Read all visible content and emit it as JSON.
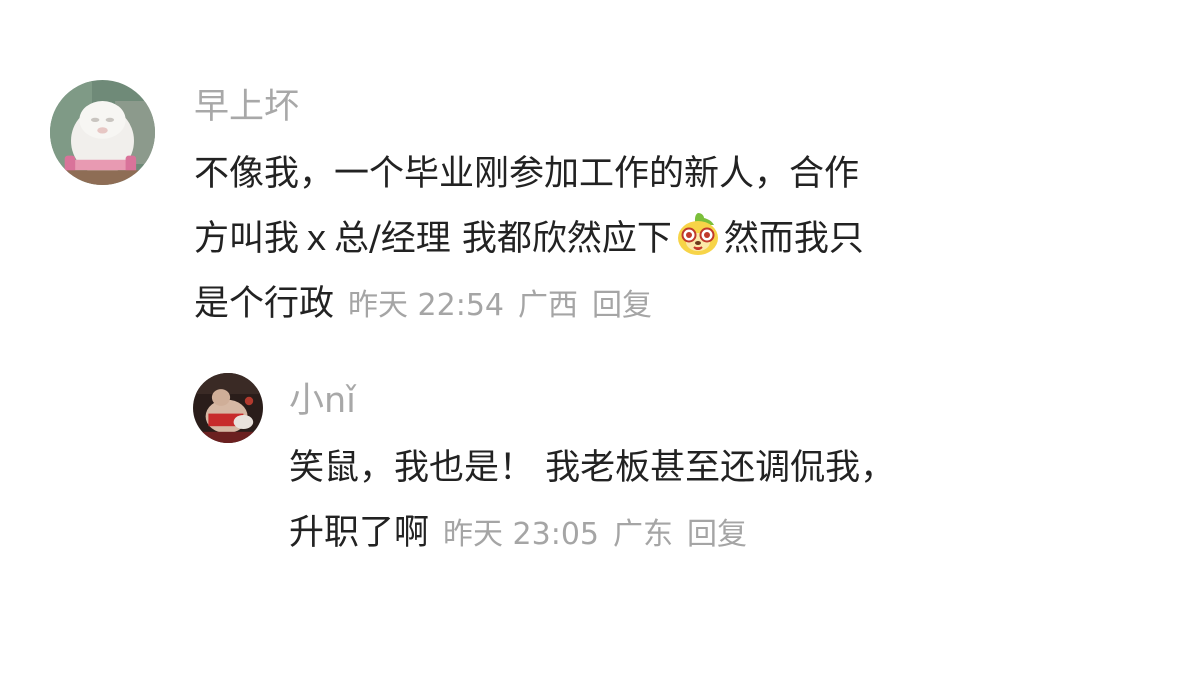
{
  "comments": [
    {
      "username": "早上坏",
      "avatar_icon": "white-fluffy-creature-avatar",
      "text_lines": [
        "不像我，一个毕业刚参加工作的新人，合作",
        "方叫我ｘ总/经理 我都欣然应下",
        "然而我只",
        "是个行政"
      ],
      "emoji_icon": "lemon-face-emoji",
      "time": "昨天 22:54",
      "location": "广西",
      "reply_label": "回复"
    },
    {
      "username": "小nǐ",
      "avatar_icon": "wrestler-avatar",
      "text_lines": [
        "笑鼠，我也是！ 我老板甚至还调侃我，",
        "升职了啊"
      ],
      "time": "昨天 23:05",
      "location": "广东",
      "reply_label": "回复"
    }
  ],
  "colors": {
    "text": "#222222",
    "username": "#a8a8a8",
    "meta": "#a5a5a5",
    "background": "#ffffff"
  }
}
